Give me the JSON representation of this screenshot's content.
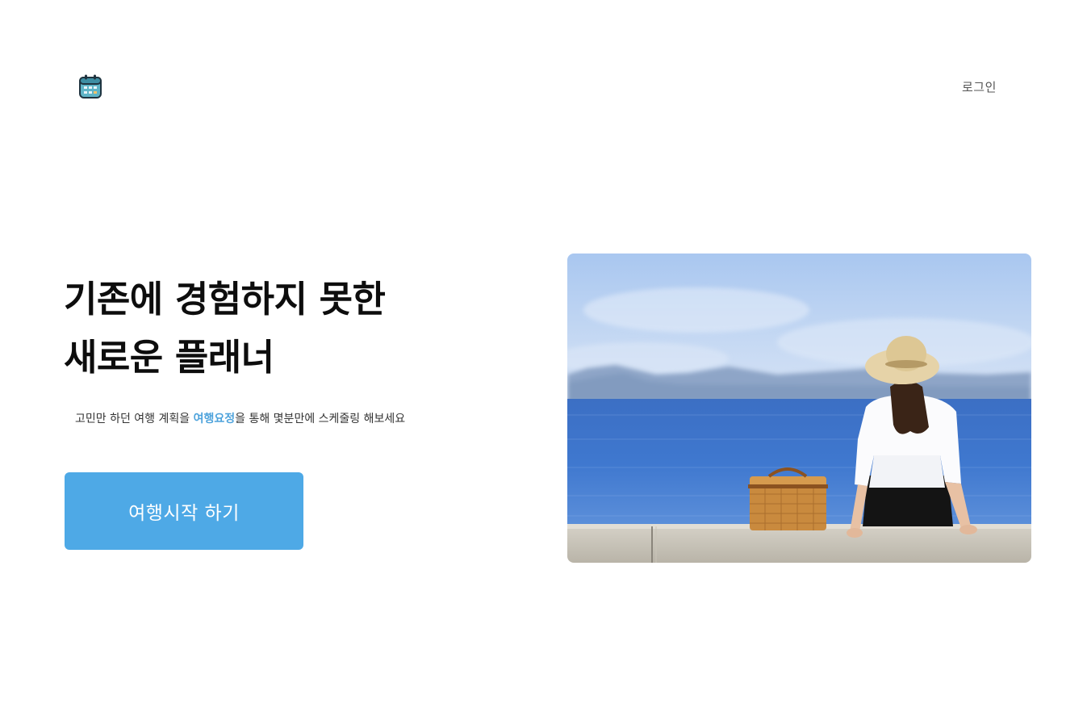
{
  "header": {
    "logo_icon": "calendar-icon",
    "login_label": "로그인"
  },
  "hero": {
    "title_line1": "기존에 경험하지 못한",
    "title_line2": "새로운 플래너",
    "subtitle_before": "고민만 하던 여행 계획을 ",
    "subtitle_brand": "여행요정",
    "subtitle_after": "을 통해 몇분만에 스케줄링 해보세요",
    "cta_label": "여행시작 하기",
    "image_subject": "woman-with-hat-sitting-by-sea-photo"
  },
  "colors": {
    "accent": "#4ea9e6",
    "brand_text": "#4ea3dc",
    "title_text": "#0d0d0d"
  }
}
